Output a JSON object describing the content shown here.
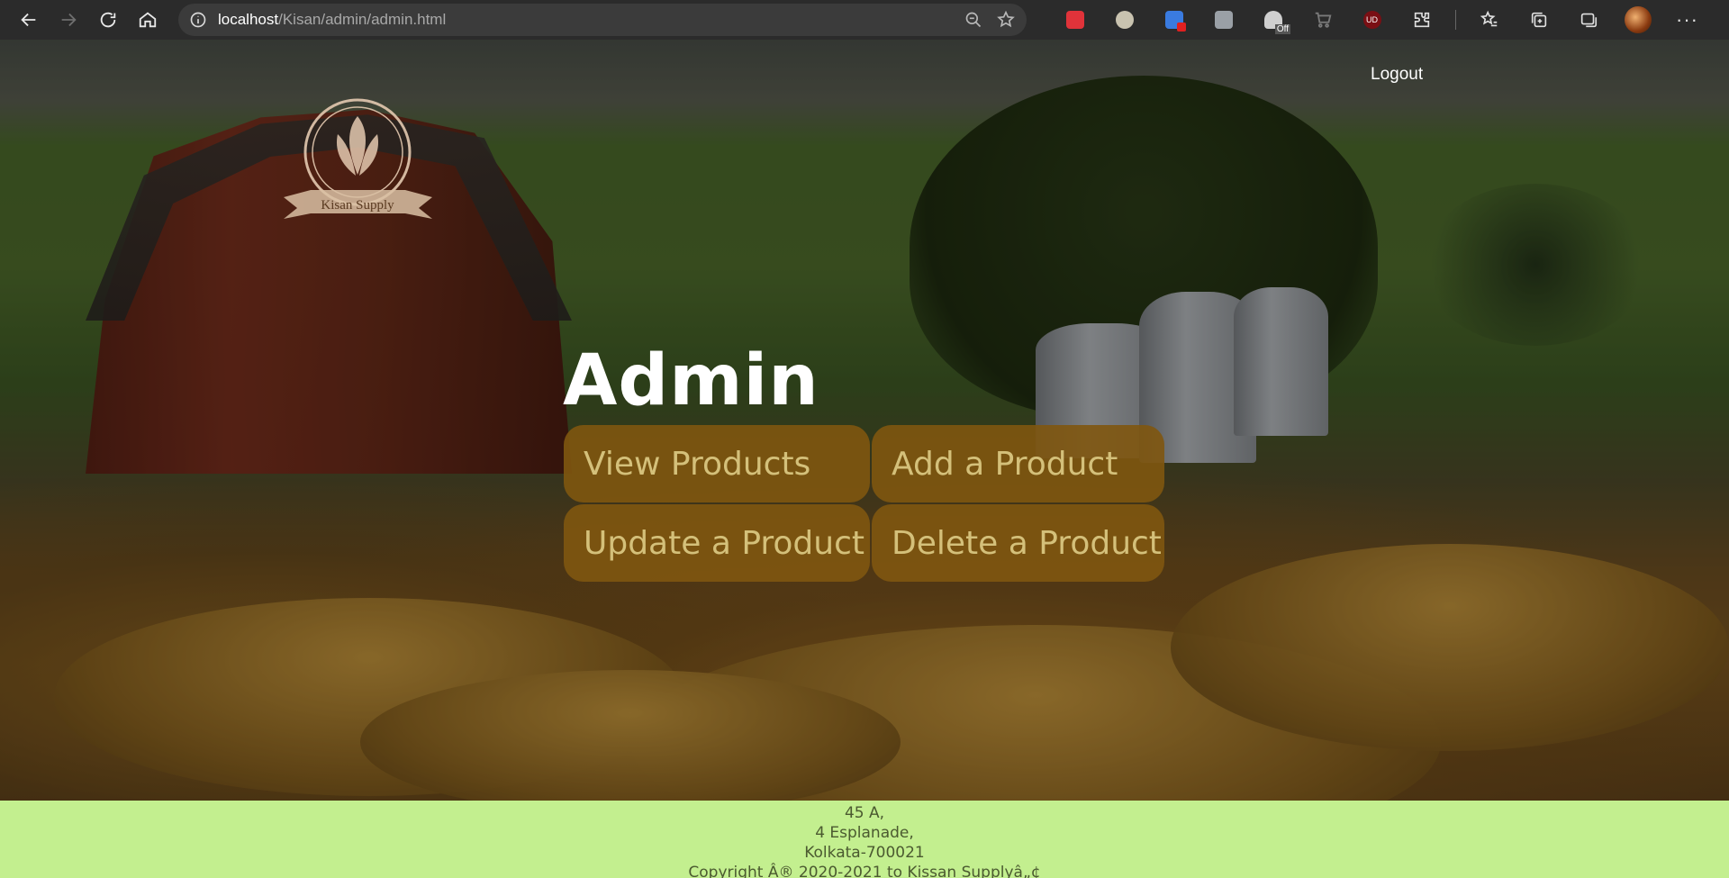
{
  "browser": {
    "url_host": "localhost",
    "url_path": "/Kisan/admin/admin.html",
    "ext_off_badge": "Off",
    "ext_ud_label": "UD",
    "more_label": "···"
  },
  "header": {
    "logo_text": "Kisan Supply",
    "logout_label": "Logout"
  },
  "main": {
    "title": "Admin",
    "buttons": {
      "view": "View Products",
      "add": "Add a Product",
      "update": "Update a Product",
      "delete": "Delete a Product"
    }
  },
  "footer": {
    "line1": "45 A,",
    "line2": "4 Esplanade,",
    "line3": "Kolkata-700021",
    "line4": "Copyright Â® 2020-2021 to Kissan Supplyâ„¢"
  },
  "colors": {
    "button_bg": "#805610",
    "button_text": "#d4c07a",
    "footer_bg": "#c3ef8f"
  }
}
